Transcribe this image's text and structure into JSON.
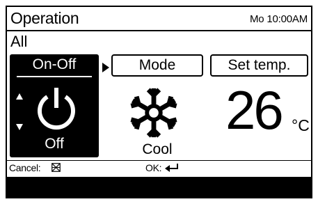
{
  "header": {
    "title": "Operation",
    "clock": "Mo 10:00AM"
  },
  "group": {
    "name": "All"
  },
  "onoff": {
    "label": "On-Off",
    "status": "Off",
    "icon": "power-icon"
  },
  "mode": {
    "label": "Mode",
    "status": "Cool",
    "icon": "snowflake-icon"
  },
  "set_temp": {
    "label": "Set temp.",
    "value": "26",
    "unit": "°C"
  },
  "footer": {
    "cancel_label": "Cancel:",
    "cancel_icon": "cancel-x-icon",
    "ok_label": "OK:",
    "ok_icon": "enter-icon"
  },
  "colors": {
    "foreground": "#000000",
    "background": "#ffffff"
  }
}
